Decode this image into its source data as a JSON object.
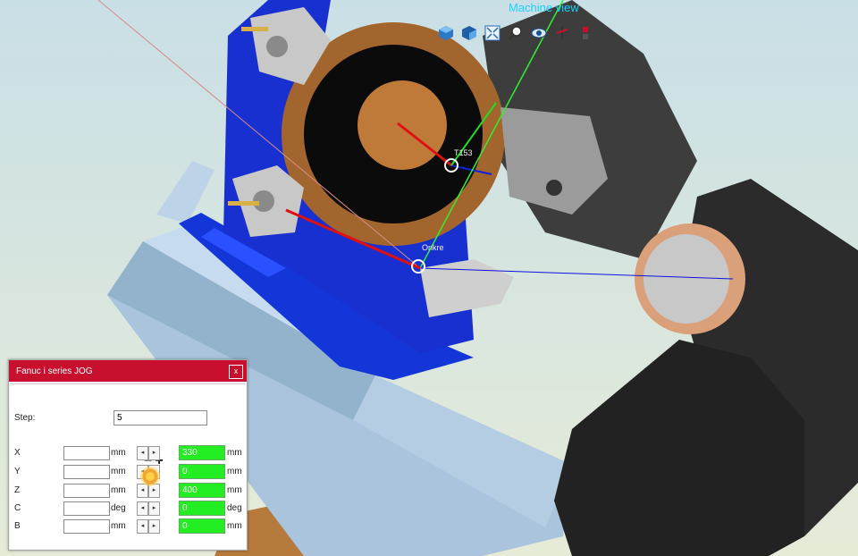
{
  "viewport": {
    "label": "Machine view",
    "labels": {
      "tool_label": "T153",
      "origin_label": "Onkre"
    },
    "toolbar": [
      {
        "name": "view-iso-icon"
      },
      {
        "name": "view-front-icon"
      },
      {
        "name": "fit-view-icon"
      },
      {
        "name": "zoom-icon"
      },
      {
        "name": "eye-view-icon"
      },
      {
        "name": "axis-toggle-icon"
      },
      {
        "name": "settings-icon"
      }
    ]
  },
  "dialog": {
    "title": "Fanuc i series JOG",
    "close": "x",
    "step_label": "Step:",
    "step_value": "5",
    "minus_plus": "−+",
    "axes": [
      {
        "axis": "X",
        "input": "",
        "unit": "mm",
        "value": "330",
        "unit2": "mm"
      },
      {
        "axis": "Y",
        "input": "",
        "unit": "mm",
        "value": "0",
        "unit2": "mm"
      },
      {
        "axis": "Z",
        "input": "",
        "unit": "mm",
        "value": "400",
        "unit2": "mm"
      },
      {
        "axis": "C",
        "input": "",
        "unit": "deg",
        "value": "0",
        "unit2": "deg"
      },
      {
        "axis": "B",
        "input": "",
        "unit": "mm",
        "value": "0",
        "unit2": "mm"
      }
    ]
  }
}
